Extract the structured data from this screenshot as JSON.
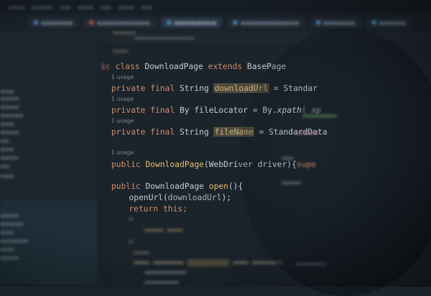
{
  "code": {
    "l1": {
      "keyword": "ic",
      "kw_class": "class",
      "name": "DownloadPage",
      "kw_extends": "extends",
      "parent": "BasePage"
    },
    "usage1": "1 usage",
    "l2": {
      "mods": "private final",
      "type": "String",
      "field": "downloadUrl",
      "rest": " = Standar"
    },
    "usage2": "1 usage",
    "l3": {
      "mods": "private final",
      "type": "By",
      "field": "fileLocator",
      "rest": " = By.",
      "method": "xpath",
      "tail": "( xp"
    },
    "usage3": "1 usage",
    "l4": {
      "mods": "private final",
      "type": "String",
      "field": "fileName",
      "rest": " = StandardData"
    },
    "usage4": "1 usage",
    "l5": {
      "mod": "public",
      "name": "DownloadPage",
      "params": "(WebDriver driver){",
      "tail": "supe"
    },
    "l6": {
      "mod": "public",
      "type": "DownloadPage",
      "method": "open",
      "rest": "(){"
    },
    "l7": {
      "call": "openUrl(",
      "arg": "downloadUrl",
      "end": ");"
    },
    "l8": {
      "kw": "return",
      "rest": " this;"
    }
  },
  "colors": {
    "background": "#1b232b",
    "keyword": "#cf8e6d",
    "method": "#e8bf6a",
    "highlight": "#4e4a3b"
  }
}
